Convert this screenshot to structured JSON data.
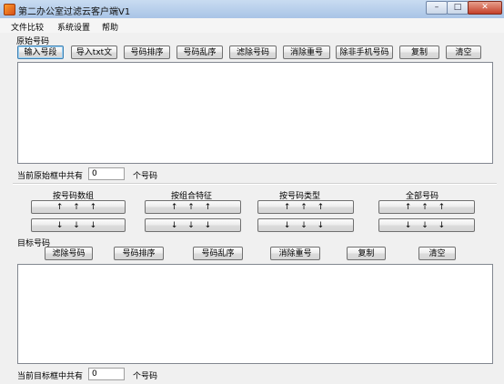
{
  "window": {
    "title": "第二办公室过滤云客户端V1",
    "min": "–",
    "max": "□",
    "close": "✕"
  },
  "menu": [
    "文件比较",
    "系统设置",
    "帮助"
  ],
  "source": {
    "label": "原始号码",
    "buttons": [
      "输入号段",
      "导入txt文",
      "号码排序",
      "号码乱序",
      "滤除号码",
      "消除重号",
      "除非手机号码",
      "复制",
      "清空"
    ],
    "count_prefix": "当前原始框中共有",
    "count_value": "0",
    "count_suffix": "个号码"
  },
  "transfer": {
    "columns": [
      {
        "label": "按号码数组",
        "up": "↑ ↑ ↑",
        "down": "↓ ↓ ↓"
      },
      {
        "label": "按组合特征",
        "up": "↑ ↑ ↑",
        "down": "↓ ↓ ↓"
      },
      {
        "label": "按号码类型",
        "up": "↑ ↑ ↑",
        "down": "↓ ↓ ↓"
      },
      {
        "label": "全部号码",
        "up": "↑ ↑ ↑",
        "down": "↓ ↓ ↓"
      }
    ]
  },
  "target": {
    "label": "目标号码",
    "buttons": [
      "滤除号码",
      "号码排序",
      "号码乱序",
      "消除重号",
      "复制",
      "清空"
    ],
    "count_prefix": "当前目标框中共有",
    "count_value": "0",
    "count_suffix": "个号码"
  }
}
